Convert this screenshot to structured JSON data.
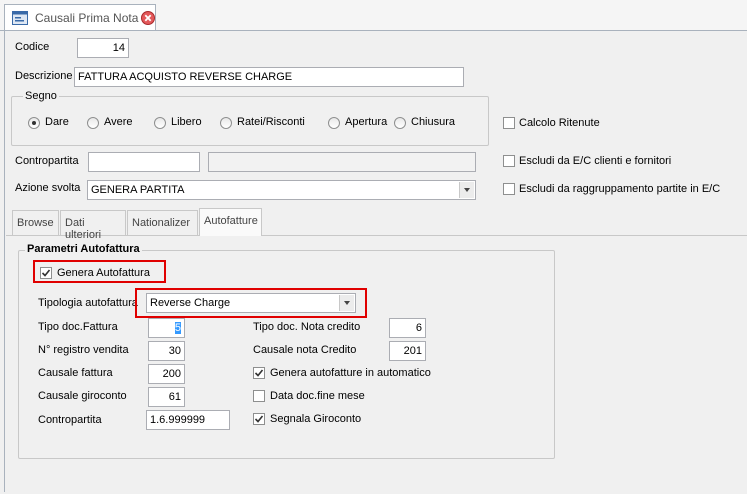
{
  "window": {
    "tab_title": "Causali Prima Nota",
    "icon": "form-icon",
    "close_icon": "close-icon"
  },
  "form": {
    "codice_label": "Codice",
    "codice_value": "14",
    "descrizione_label": "Descrizione",
    "descrizione_value": "FATTURA ACQUISTO REVERSE CHARGE",
    "segno": {
      "title": "Segno",
      "options": [
        "Dare",
        "Avere",
        "Libero",
        "Ratei/Risconti",
        "Apertura",
        "Chiusura"
      ],
      "selected": "Dare"
    },
    "calcolo_ritenute_label": "Calcolo Ritenute",
    "contropartita_label": "Contropartita",
    "contropartita_value": "",
    "contropartita_desc": "",
    "escludi_ec_label": "Escludi da E/C clienti e fornitori",
    "azione_label": "Azione svolta",
    "azione_value": "GENERA PARTITA",
    "escludi_raggr_label": "Escludi da raggruppamento partite in E/C"
  },
  "tabs": [
    {
      "label": "Browse",
      "active": false
    },
    {
      "label": "Dati ulteriori",
      "active": false
    },
    {
      "label": "Nationalizer",
      "active": false
    },
    {
      "label": "Autofatture",
      "active": true
    }
  ],
  "autofatture": {
    "group_title": "Parametri Autofattura",
    "genera_label": "Genera Autofattura",
    "genera_checked": true,
    "tipologia_label": "Tipologia autofattura",
    "tipologia_value": "Reverse Charge",
    "tipo_doc_fattura_label": "Tipo doc.Fattura",
    "tipo_doc_fattura_value": "5",
    "registro_label": "N° registro vendita",
    "registro_value": "30",
    "causale_fattura_label": "Causale fattura",
    "causale_fattura_value": "200",
    "causale_giroconto_label": "Causale giroconto",
    "causale_giroconto_value": "61",
    "contropartita_label": "Contropartita",
    "contropartita_value": "1.6.999999",
    "tipo_doc_nota_label": "Tipo doc. Nota credito",
    "tipo_doc_nota_value": "6",
    "causale_nota_label": "Causale nota Credito",
    "causale_nota_value": "201",
    "genera_auto_label": "Genera autofatture in automatico",
    "genera_auto_checked": true,
    "data_doc_label": "Data doc.fine mese",
    "data_doc_checked": false,
    "segnala_label": "Segnala Giroconto",
    "segnala_checked": true
  },
  "colors": {
    "highlight": "#e00000",
    "border": "#abadb3"
  }
}
